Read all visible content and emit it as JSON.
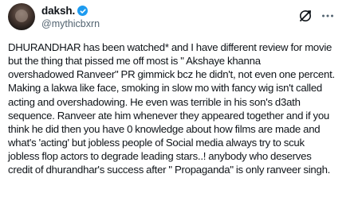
{
  "tweet": {
    "display_name": "daksh.",
    "handle": "@mythicbxrn",
    "lines": [
      "DHURANDHAR has been watched* and I have different review for movie",
      "but the thing that pissed me off most is \" Akshaye khanna",
      "overshadowed Ranveer\" PR gimmick bcz he didn't, not even one percent.",
      "Making a lakwa like face, smoking in slow mo with fancy wig isn't called",
      "acting and overshadowing. He even was terrible in his son's d3ath",
      "sequence. Ranveer ate him whenever they appeared together and if you",
      "think he did then you have 0 knowledge about how films are made and",
      "what's 'acting' but jobless people of Social media always try to scuk",
      "jobless flop actors to degrade leading stars..!  anybody who deserves",
      "credit of dhurandhar's success after \" Propaganda\" is only ranveer singh."
    ]
  },
  "icons": {
    "verified": "verified-badge-icon",
    "grok": "grok-icon",
    "more": "more-options-icon"
  },
  "colors": {
    "verified": "#1d9bf0",
    "text": "#0f1419",
    "secondary": "#536471"
  }
}
